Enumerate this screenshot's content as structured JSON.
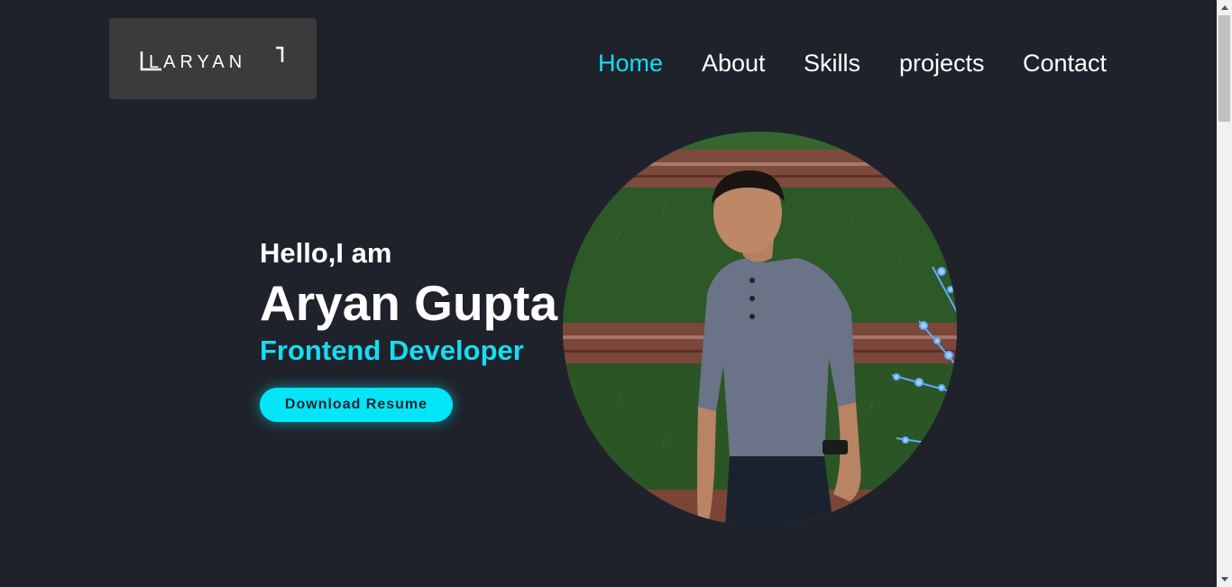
{
  "brand": {
    "logo_text": "LARYAN"
  },
  "nav": {
    "items": [
      {
        "label": "Home",
        "active": true
      },
      {
        "label": "About"
      },
      {
        "label": "Skills"
      },
      {
        "label": "projects"
      },
      {
        "label": "Contact"
      }
    ]
  },
  "hero": {
    "greeting": "Hello,I am",
    "name": "Aryan Gupta",
    "role": "Frontend Developer",
    "cta_label": "Download Resume"
  },
  "colors": {
    "background": "#1f222b",
    "accent": "#17dcf0",
    "button": "#04e6f8",
    "logo_box": "#3b3b3b"
  }
}
